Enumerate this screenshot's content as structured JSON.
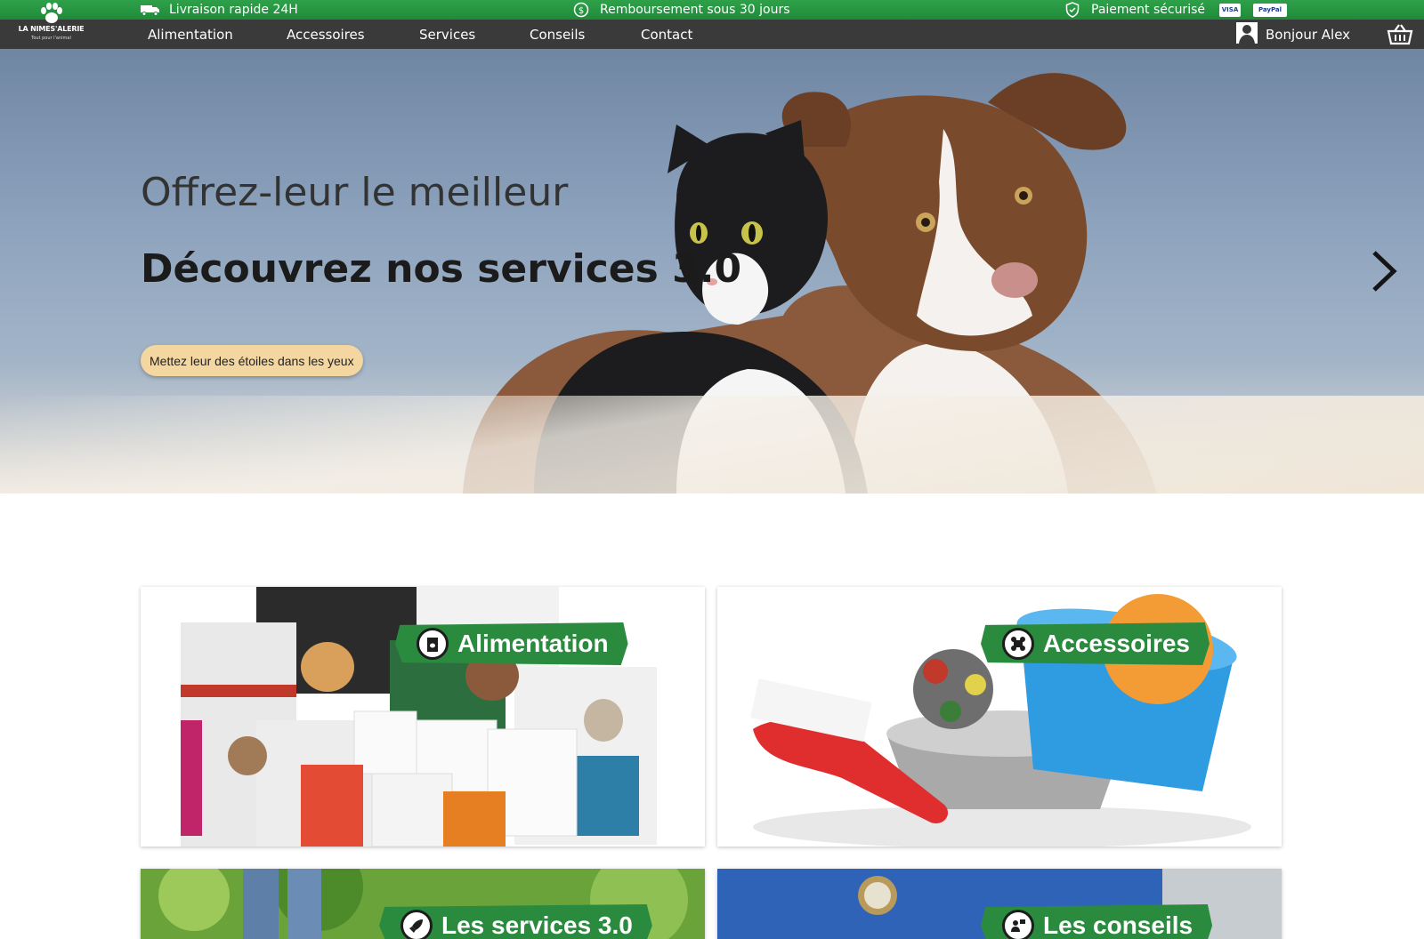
{
  "topbar": {
    "delivery": "Livraison rapide 24H",
    "refund": "Remboursement  sous 30 jours",
    "secure": "Paiement sécurisé",
    "pay_visa": "VISA",
    "pay_paypal": "PayPal"
  },
  "brand": {
    "name": "LA NIMES'ALERIE",
    "tagline": "Tout pour l'animal"
  },
  "nav": {
    "items": [
      "Alimentation",
      "Accessoires",
      "Services",
      "Conseils",
      "Contact"
    ],
    "account": "Bonjour Alex"
  },
  "hero": {
    "title": "Offrez-leur le meilleur",
    "subtitle": "Découvrez nos services 3.0",
    "cta": "Mettez leur des étoiles dans les yeux"
  },
  "categories": [
    {
      "label": "Alimentation"
    },
    {
      "label": "Accessoires"
    },
    {
      "label": "Les services 3.0"
    },
    {
      "label": "Les conseils"
    }
  ],
  "colors": {
    "topbar_green": "#2fa14a",
    "nav_dark": "#3a3a3a",
    "label_green": "#2a8a3e",
    "cta_beige": "#f3d6a0"
  }
}
